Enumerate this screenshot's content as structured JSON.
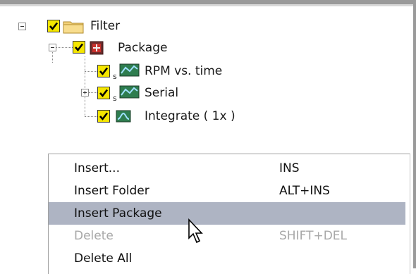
{
  "tree": {
    "items": [
      {
        "label": "Filter",
        "icon": "folder-icon",
        "expander": "minus"
      },
      {
        "label": "Package",
        "icon": "package-icon",
        "expander": "minus"
      },
      {
        "label": "RPM vs. time",
        "icon": "graph-s-icon",
        "expander": "none"
      },
      {
        "label": "Serial",
        "icon": "graph-s-icon",
        "expander": "plus"
      },
      {
        "label": "Integrate ( 1x )",
        "icon": "integrate-icon",
        "expander": "none"
      }
    ]
  },
  "context_menu": {
    "items": [
      {
        "label": "Insert...",
        "shortcut": "INS",
        "state": "normal"
      },
      {
        "label": "Insert Folder",
        "shortcut": "ALT+INS",
        "state": "normal"
      },
      {
        "label": "Insert Package",
        "shortcut": "",
        "state": "highlighted"
      },
      {
        "label": "Delete",
        "shortcut": "SHIFT+DEL",
        "state": "disabled"
      },
      {
        "label": "Delete All",
        "shortcut": "",
        "state": "normal"
      }
    ]
  },
  "colors": {
    "highlight": "#aeb4c3",
    "checkbox": "#f5e600",
    "disabled_text": "#a8a8a8"
  }
}
